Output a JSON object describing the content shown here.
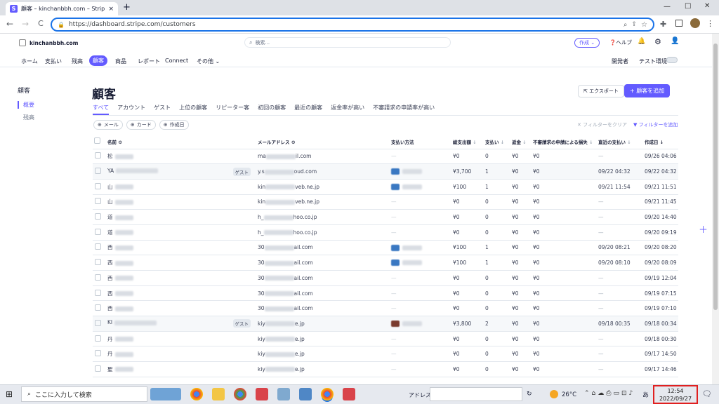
{
  "browser": {
    "tab_title": "顧客 – kinchanbbh.com – Stripe",
    "tab_close": "×",
    "new_tab": "+",
    "url": "https://dashboard.stripe.com/customers",
    "back": "←",
    "forward": "→",
    "reload": "C",
    "minimize": "—",
    "maximize": "□",
    "close": "✕"
  },
  "header": {
    "account": "kinchanbbh.com",
    "search_placeholder": "検索...",
    "create_label": "作成",
    "help_label": "ヘルプ"
  },
  "menu": {
    "items": [
      "ホーム",
      "支払い",
      "残高",
      "顧客",
      "商品",
      "レポート",
      "Connect",
      "その他"
    ],
    "developer": "開発者",
    "test_mode": "テスト環境"
  },
  "sidebar": {
    "title": "顧客",
    "items": [
      "概要",
      "残高"
    ]
  },
  "main": {
    "title": "顧客",
    "export_label": "エクスポート",
    "add_label": "顧客を追加",
    "tabs": [
      "すべて",
      "アカウント",
      "ゲスト",
      "上位の顧客",
      "リピーター客",
      "初回の顧客",
      "最近の顧客",
      "返金率が高い",
      "不審請求の申請率が高い"
    ],
    "filters": [
      "メール",
      "カード",
      "作成日"
    ],
    "clear_filters": "フィルターをクリア",
    "add_filter": "フィルターを追加"
  },
  "table": {
    "columns": [
      "名前",
      "メールアドレス",
      "支払い方法",
      "総支出額",
      "支払い",
      "返金",
      "不審請求の申請による損失",
      "直近の支払い",
      "作成日"
    ],
    "rows": [
      {
        "name": "松",
        "guest": "",
        "email": "ma",
        "email_end": "il.com",
        "pm": "—",
        "pm_card": "",
        "spend": "¥0",
        "payments": "0",
        "refunds": "¥0",
        "dispute": "¥0",
        "last": "—",
        "created": "09/26 04:06"
      },
      {
        "name": "YA",
        "guest": "ゲスト",
        "email": "y.s",
        "email_end": "oud.com",
        "pm": "",
        "pm_card": "blue",
        "spend": "¥3,700",
        "payments": "1",
        "refunds": "¥0",
        "dispute": "¥0",
        "last": "09/22 04:32",
        "created": "09/22 04:32"
      },
      {
        "name": "山",
        "guest": "",
        "email": "kin",
        "email_end": "veb.ne.jp",
        "pm": "",
        "pm_card": "blue",
        "spend": "¥100",
        "payments": "1",
        "refunds": "¥0",
        "dispute": "¥0",
        "last": "09/21 11:54",
        "created": "09/21 11:51"
      },
      {
        "name": "山",
        "guest": "",
        "email": "kin",
        "email_end": "veb.ne.jp",
        "pm": "—",
        "pm_card": "",
        "spend": "¥0",
        "payments": "0",
        "refunds": "¥0",
        "dispute": "¥0",
        "last": "—",
        "created": "09/21 11:45"
      },
      {
        "name": "道",
        "guest": "",
        "email": "h_",
        "email_end": "hoo.co.jp",
        "pm": "—",
        "pm_card": "",
        "spend": "¥0",
        "payments": "0",
        "refunds": "¥0",
        "dispute": "¥0",
        "last": "—",
        "created": "09/20 14:40"
      },
      {
        "name": "道",
        "guest": "",
        "email": "h_",
        "email_end": "hoo.co.jp",
        "pm": "—",
        "pm_card": "",
        "spend": "¥0",
        "payments": "0",
        "refunds": "¥0",
        "dispute": "¥0",
        "last": "—",
        "created": "09/20 09:19"
      },
      {
        "name": "西",
        "guest": "",
        "email": "30",
        "email_end": "ail.com",
        "pm": "",
        "pm_card": "blue",
        "spend": "¥100",
        "payments": "1",
        "refunds": "¥0",
        "dispute": "¥0",
        "last": "09/20 08:21",
        "created": "09/20 08:20"
      },
      {
        "name": "西",
        "guest": "",
        "email": "30",
        "email_end": "ail.com",
        "pm": "",
        "pm_card": "blue",
        "spend": "¥100",
        "payments": "1",
        "refunds": "¥0",
        "dispute": "¥0",
        "last": "09/20 08:10",
        "created": "09/20 08:09"
      },
      {
        "name": "西",
        "guest": "",
        "email": "30",
        "email_end": "ail.com",
        "pm": "—",
        "pm_card": "",
        "spend": "¥0",
        "payments": "0",
        "refunds": "¥0",
        "dispute": "¥0",
        "last": "—",
        "created": "09/19 12:04"
      },
      {
        "name": "西",
        "guest": "",
        "email": "30",
        "email_end": "ail.com",
        "pm": "—",
        "pm_card": "",
        "spend": "¥0",
        "payments": "0",
        "refunds": "¥0",
        "dispute": "¥0",
        "last": "—",
        "created": "09/19 07:15"
      },
      {
        "name": "西",
        "guest": "",
        "email": "30",
        "email_end": "ail.com",
        "pm": "—",
        "pm_card": "",
        "spend": "¥0",
        "payments": "0",
        "refunds": "¥0",
        "dispute": "¥0",
        "last": "—",
        "created": "09/19 07:10"
      },
      {
        "name": "KI",
        "guest": "ゲスト",
        "email": "kiy",
        "email_end": "e.jp",
        "pm": "",
        "pm_card": "brown",
        "spend": "¥3,800",
        "payments": "2",
        "refunds": "¥0",
        "dispute": "¥0",
        "last": "09/18 00:35",
        "created": "09/18 00:34"
      },
      {
        "name": "丹",
        "guest": "",
        "email": "kiy",
        "email_end": "e.jp",
        "pm": "—",
        "pm_card": "",
        "spend": "¥0",
        "payments": "0",
        "refunds": "¥0",
        "dispute": "¥0",
        "last": "—",
        "created": "09/18 00:30"
      },
      {
        "name": "丹",
        "guest": "",
        "email": "kiy",
        "email_end": "e.jp",
        "pm": "—",
        "pm_card": "",
        "spend": "¥0",
        "payments": "0",
        "refunds": "¥0",
        "dispute": "¥0",
        "last": "—",
        "created": "09/17 14:50"
      },
      {
        "name": "聖",
        "guest": "",
        "email": "kiy",
        "email_end": "e.jp",
        "pm": "—",
        "pm_card": "",
        "spend": "¥0",
        "payments": "0",
        "refunds": "¥0",
        "dispute": "¥0",
        "last": "—",
        "created": "09/17 14:46"
      }
    ]
  },
  "taskbar": {
    "search_placeholder": "ここに入力して検索",
    "address_label": "アドレス",
    "weather": "26°C",
    "time": "12:54",
    "date": "2022/09/27",
    "ime": "あ",
    "colors": {
      "accent": "#635bff",
      "highlight": "#e02020"
    }
  }
}
